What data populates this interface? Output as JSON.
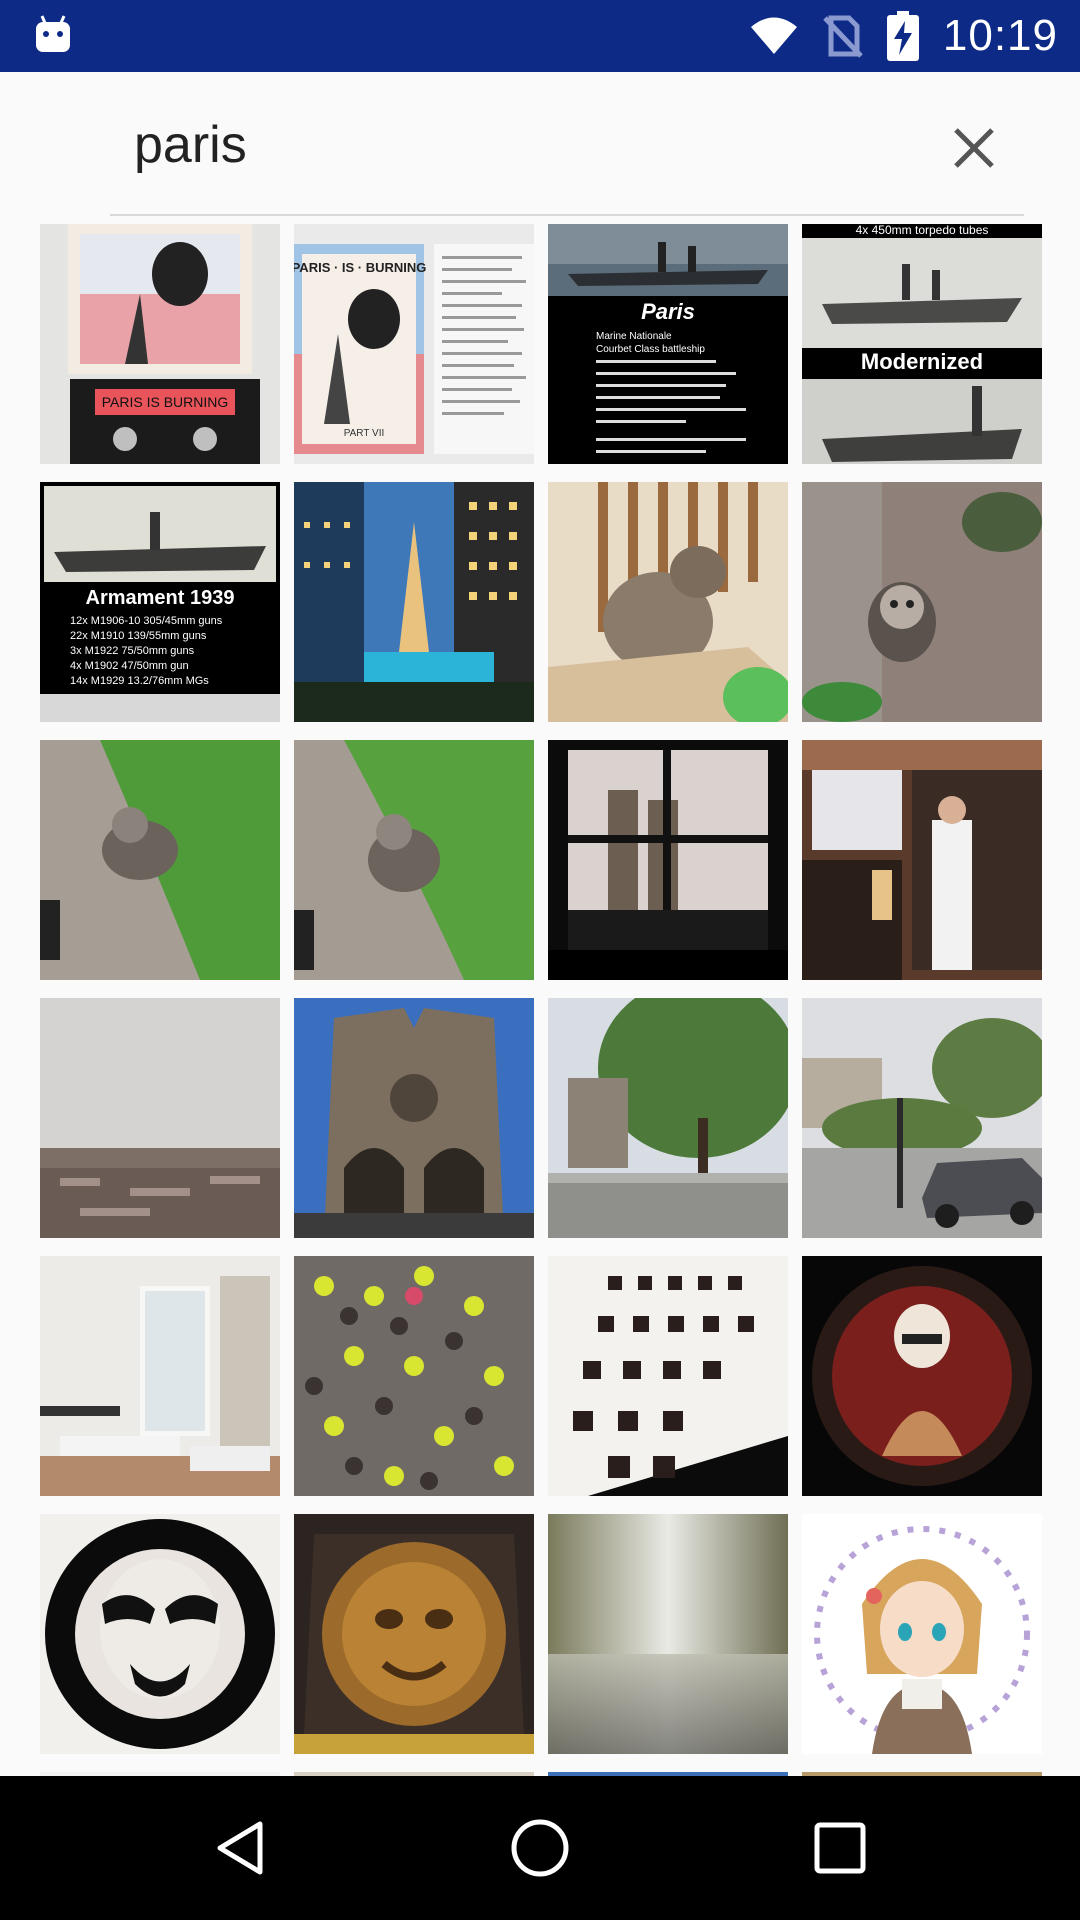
{
  "status_bar": {
    "time": "10:19",
    "icons": [
      "android-notification-icon",
      "wifi-icon",
      "no-sim-icon",
      "battery-charging-icon"
    ]
  },
  "search": {
    "query": "paris",
    "placeholder": "",
    "clear_icon": "close-icon"
  },
  "results": {
    "tiles": [
      {
        "name": "result-paris-is-burning-cassette",
        "text": [
          "PARIS IS BURNING"
        ]
      },
      {
        "name": "result-paris-is-burning-cover",
        "text": [
          "PARIS · IS · BURNING",
          "PART VII"
        ]
      },
      {
        "name": "result-battleship-paris",
        "text": [
          "Paris",
          "Marine Nationale",
          "Courbet Class battleship"
        ]
      },
      {
        "name": "result-battleship-modernized",
        "text": [
          "4x 450mm torpedo tubes",
          "Modernized"
        ]
      },
      {
        "name": "result-battleship-armament",
        "text": [
          "Armament 1939",
          "12x M1906-10 305/45mm guns",
          "22x M1910 139/55mm guns",
          "3x M1922 75/50mm guns",
          "4x M1902 47/50mm gun",
          "14x M1929 13.2/76mm MGs"
        ]
      },
      {
        "name": "result-eiffel-tower-model",
        "text": []
      },
      {
        "name": "result-cat-on-box",
        "text": []
      },
      {
        "name": "result-kitten-by-wall",
        "text": []
      },
      {
        "name": "result-kitten-grass-1",
        "text": []
      },
      {
        "name": "result-kitten-grass-2",
        "text": []
      },
      {
        "name": "result-notre-dame-window",
        "text": []
      },
      {
        "name": "result-cafe-interior",
        "text": []
      },
      {
        "name": "result-paris-rooftops",
        "text": []
      },
      {
        "name": "result-notre-dame-facade",
        "text": []
      },
      {
        "name": "result-notre-dame-street",
        "text": []
      },
      {
        "name": "result-paris-street-car",
        "text": []
      },
      {
        "name": "result-white-apartment",
        "text": []
      },
      {
        "name": "result-protest-crowd",
        "text": []
      },
      {
        "name": "result-slides-lightbox",
        "text": []
      },
      {
        "name": "result-figure-peephole",
        "text": []
      },
      {
        "name": "result-mask-peephole",
        "text": []
      },
      {
        "name": "result-bronze-mask",
        "text": []
      },
      {
        "name": "result-blurred-corridor",
        "text": []
      },
      {
        "name": "result-anime-girl",
        "text": []
      }
    ]
  },
  "nav_bar": {
    "back_icon": "back-triangle-icon",
    "home_icon": "home-circle-icon",
    "recents_icon": "recents-square-icon"
  },
  "colors": {
    "status_bar": "#0d2a86",
    "background": "#fafafa",
    "nav_bar": "#000000"
  }
}
